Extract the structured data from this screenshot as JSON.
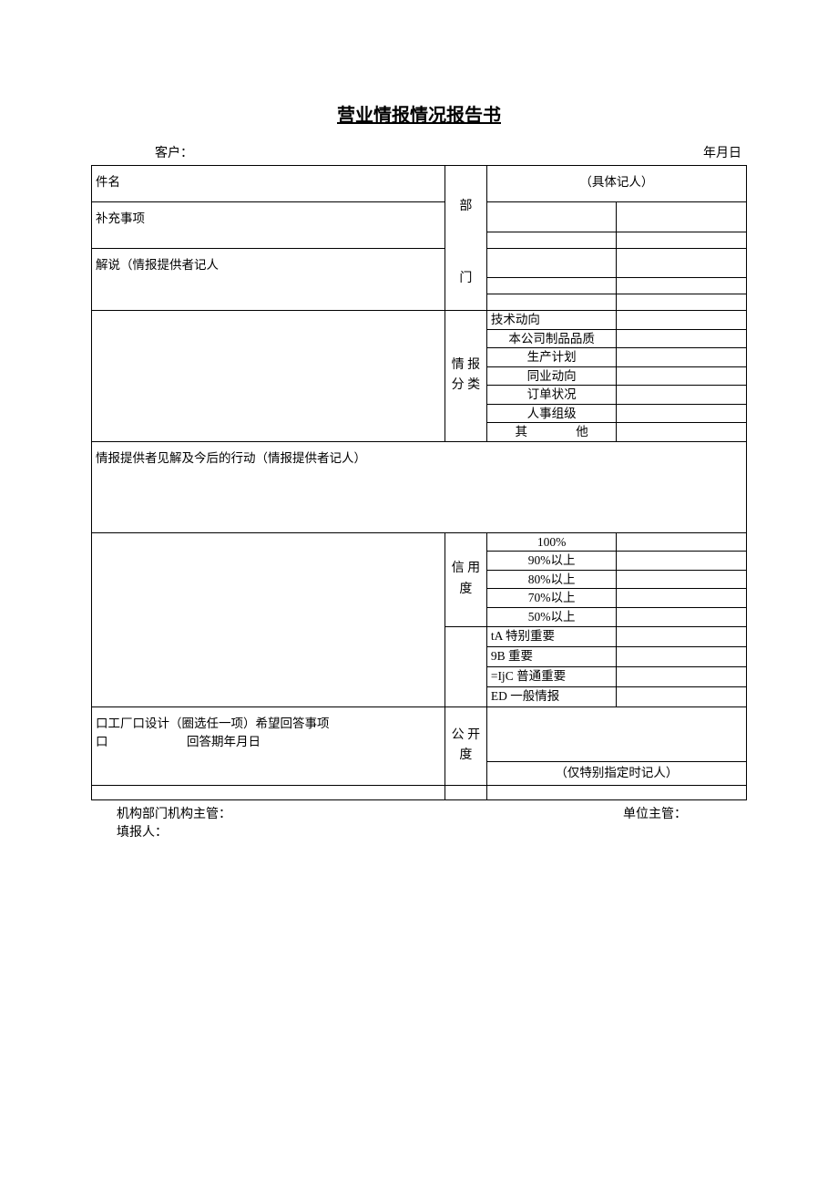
{
  "title": "营业情报情况报告书",
  "header": {
    "customer_label": "客户：",
    "date_label": "年月日"
  },
  "rows": {
    "jianming": "件名",
    "jutijiren": "（具体记人）",
    "buchong": "补充事项",
    "jieshuo": "解说（情报提供者记人",
    "bumen": "部",
    "men": "门",
    "qingbao_fenlei": "情 报 分 类",
    "cat": {
      "c1": "技术动向",
      "c2": "本公司制品品质",
      "c3": "生产计划",
      "c4": "同业动向",
      "c5": "订单状况",
      "c6": "人事组级",
      "c7_a": "其",
      "c7_b": "他"
    },
    "jianjie": "情报提供者见解及今后的行动（情报提供者记人）",
    "xinyong": "信 用 度",
    "conf": {
      "p100": "100%",
      "p90": "90%以上",
      "p80": "80%以上",
      "p70": "70%以上",
      "p50": "50%以上"
    },
    "imp": {
      "a": "tA 特别重要",
      "b": "9B 重要",
      "c": "=IjC 普通重要",
      "d": "ED 一般情报"
    },
    "hope_line1": "口工厂口设计（圈选任一项）希望回答事项",
    "hope_line2a": "口",
    "hope_line2b": "回答期年月日",
    "gongkai": "公 开 度",
    "zhiding": "（仅特别指定时记人）"
  },
  "footer": {
    "left": "机构部门机构主管：",
    "right": "单位主管：",
    "bottom": "填报人："
  }
}
